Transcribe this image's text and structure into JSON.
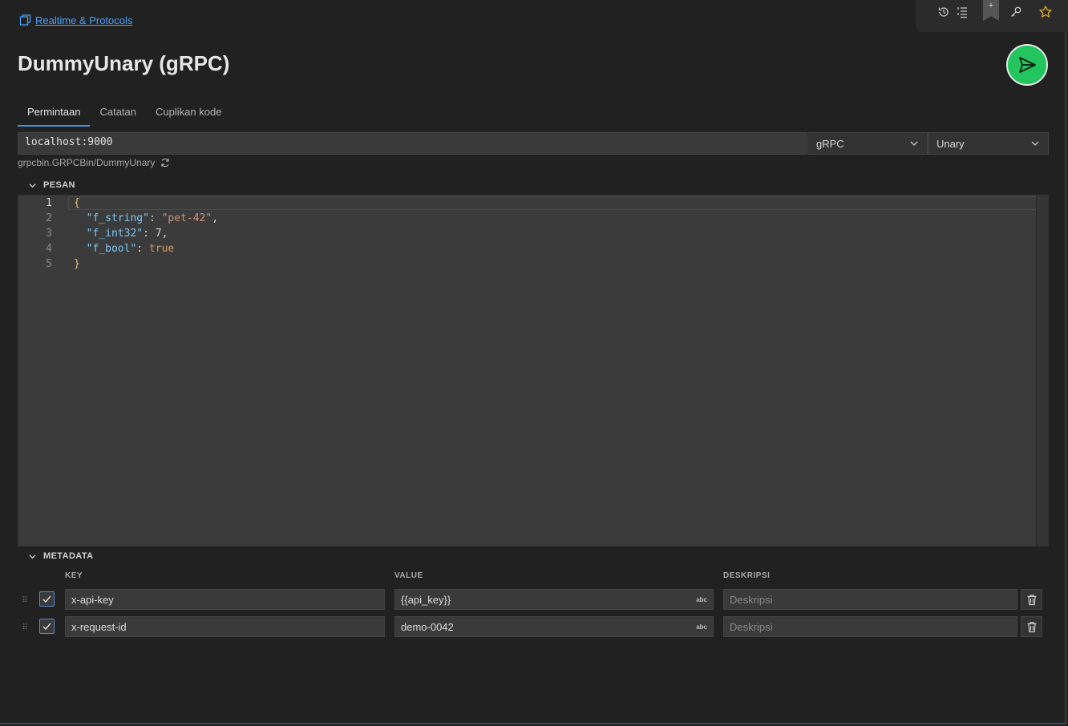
{
  "breadcrumb": {
    "label": "Realtime & Protocols",
    "icon": "collection-icon"
  },
  "toolbar": {
    "icons": [
      "history-icon",
      "list-icon",
      "bookmark-icon",
      "key-icon",
      "star-icon"
    ],
    "bookmark_plus": "+"
  },
  "request": {
    "title": "DummyUnary (gRPC)"
  },
  "send": {
    "icon": "send-icon",
    "color": "#22c55e"
  },
  "tabs": [
    {
      "label": "Permintaan",
      "active": true
    },
    {
      "label": "Catatan",
      "active": false
    },
    {
      "label": "Cuplikan kode",
      "active": false
    }
  ],
  "url": {
    "value": "localhost:9000"
  },
  "protocol": {
    "value": "gRPC"
  },
  "call_type": {
    "value": "Unary"
  },
  "method_path": {
    "value": "grpcbin.GRPCBin/DummyUnary",
    "icon": "refresh-icon"
  },
  "message_section": {
    "label": "PESAN"
  },
  "editor": {
    "line_numbers": [
      "1",
      "2",
      "3",
      "4",
      "5"
    ],
    "lines": [
      {
        "brace": "{"
      },
      {
        "key": "\"f_string\"",
        "colon": ": ",
        "value": "\"pet-42\"",
        "trail": ","
      },
      {
        "key": "\"f_int32\"",
        "colon": ": ",
        "value": "7",
        "trail": ","
      },
      {
        "key": "\"f_bool\"",
        "colon": ": ",
        "value": "true",
        "trail": ""
      },
      {
        "brace": "}"
      }
    ]
  },
  "metadata_section": {
    "label": "METADATA"
  },
  "metadata": {
    "headers": {
      "key": "KEY",
      "value": "VALUE",
      "description": "DESKRIPSI"
    },
    "rows": [
      {
        "checked": true,
        "key": "x-api-key",
        "value": "{{api_key}}",
        "value_type": "abc",
        "description_placeholder": "Deskripsi"
      },
      {
        "checked": true,
        "key": "x-request-id",
        "value": "demo-0042",
        "value_type": "abc",
        "description_placeholder": "Deskripsi"
      }
    ]
  }
}
